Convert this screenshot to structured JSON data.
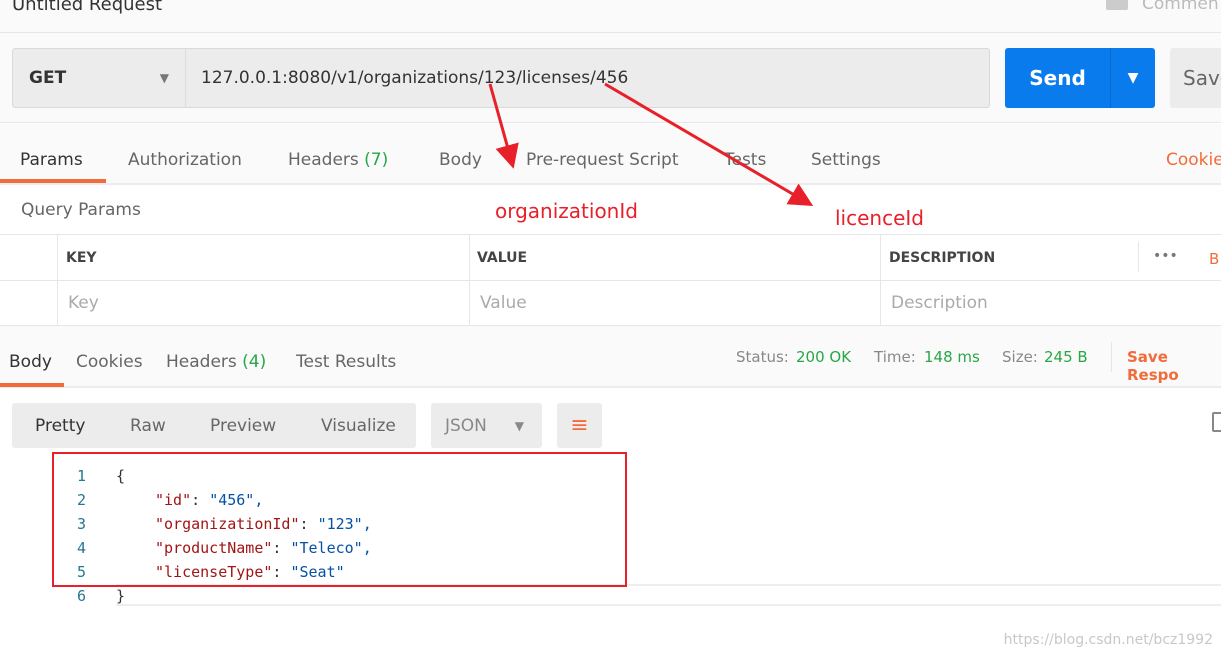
{
  "header": {
    "title": "Untitled Request",
    "comments_label": "Commen"
  },
  "request": {
    "method": "GET",
    "url": "127.0.0.1:8080/v1/organizations/123/licenses/456",
    "send_label": "Send",
    "save_label": "Save"
  },
  "tabs": [
    {
      "label": "Params"
    },
    {
      "label": "Authorization"
    },
    {
      "label": "Headers",
      "count": "(7)"
    },
    {
      "label": "Body"
    },
    {
      "label": "Pre-request Script"
    },
    {
      "label": "Tests"
    },
    {
      "label": "Settings"
    }
  ],
  "cookies_label": "Cookie",
  "query_params": {
    "title": "Query Params",
    "columns": [
      "KEY",
      "VALUE",
      "DESCRIPTION"
    ],
    "more": "•••",
    "bulk": "B",
    "placeholders": [
      "Key",
      "Value",
      "Description"
    ]
  },
  "response": {
    "tabs": [
      {
        "label": "Body"
      },
      {
        "label": "Cookies"
      },
      {
        "label": "Headers",
        "count": "(4)"
      },
      {
        "label": "Test Results"
      }
    ],
    "status_label": "Status:",
    "status": "200 OK",
    "time_label": "Time:",
    "time": "148 ms",
    "size_label": "Size:",
    "size": "245 B",
    "save_label": "Save Respo",
    "formats": [
      "Pretty",
      "Raw",
      "Preview",
      "Visualize"
    ],
    "type": "JSON",
    "lines": [
      {
        "n": "1",
        "t": "{"
      },
      {
        "n": "2",
        "k": "\"id\"",
        "v": "\"456\","
      },
      {
        "n": "3",
        "k": "\"organizationId\"",
        "v": "\"123\","
      },
      {
        "n": "4",
        "k": "\"productName\"",
        "v": "\"Teleco\","
      },
      {
        "n": "5",
        "k": "\"licenseType\"",
        "v": "\"Seat\""
      },
      {
        "n": "6",
        "t": "}"
      }
    ]
  },
  "annotations": {
    "label1": "organizationId",
    "label2": "licenceId",
    "color": "#e8202a"
  },
  "watermark": "https://blog.csdn.net/bcz1992"
}
